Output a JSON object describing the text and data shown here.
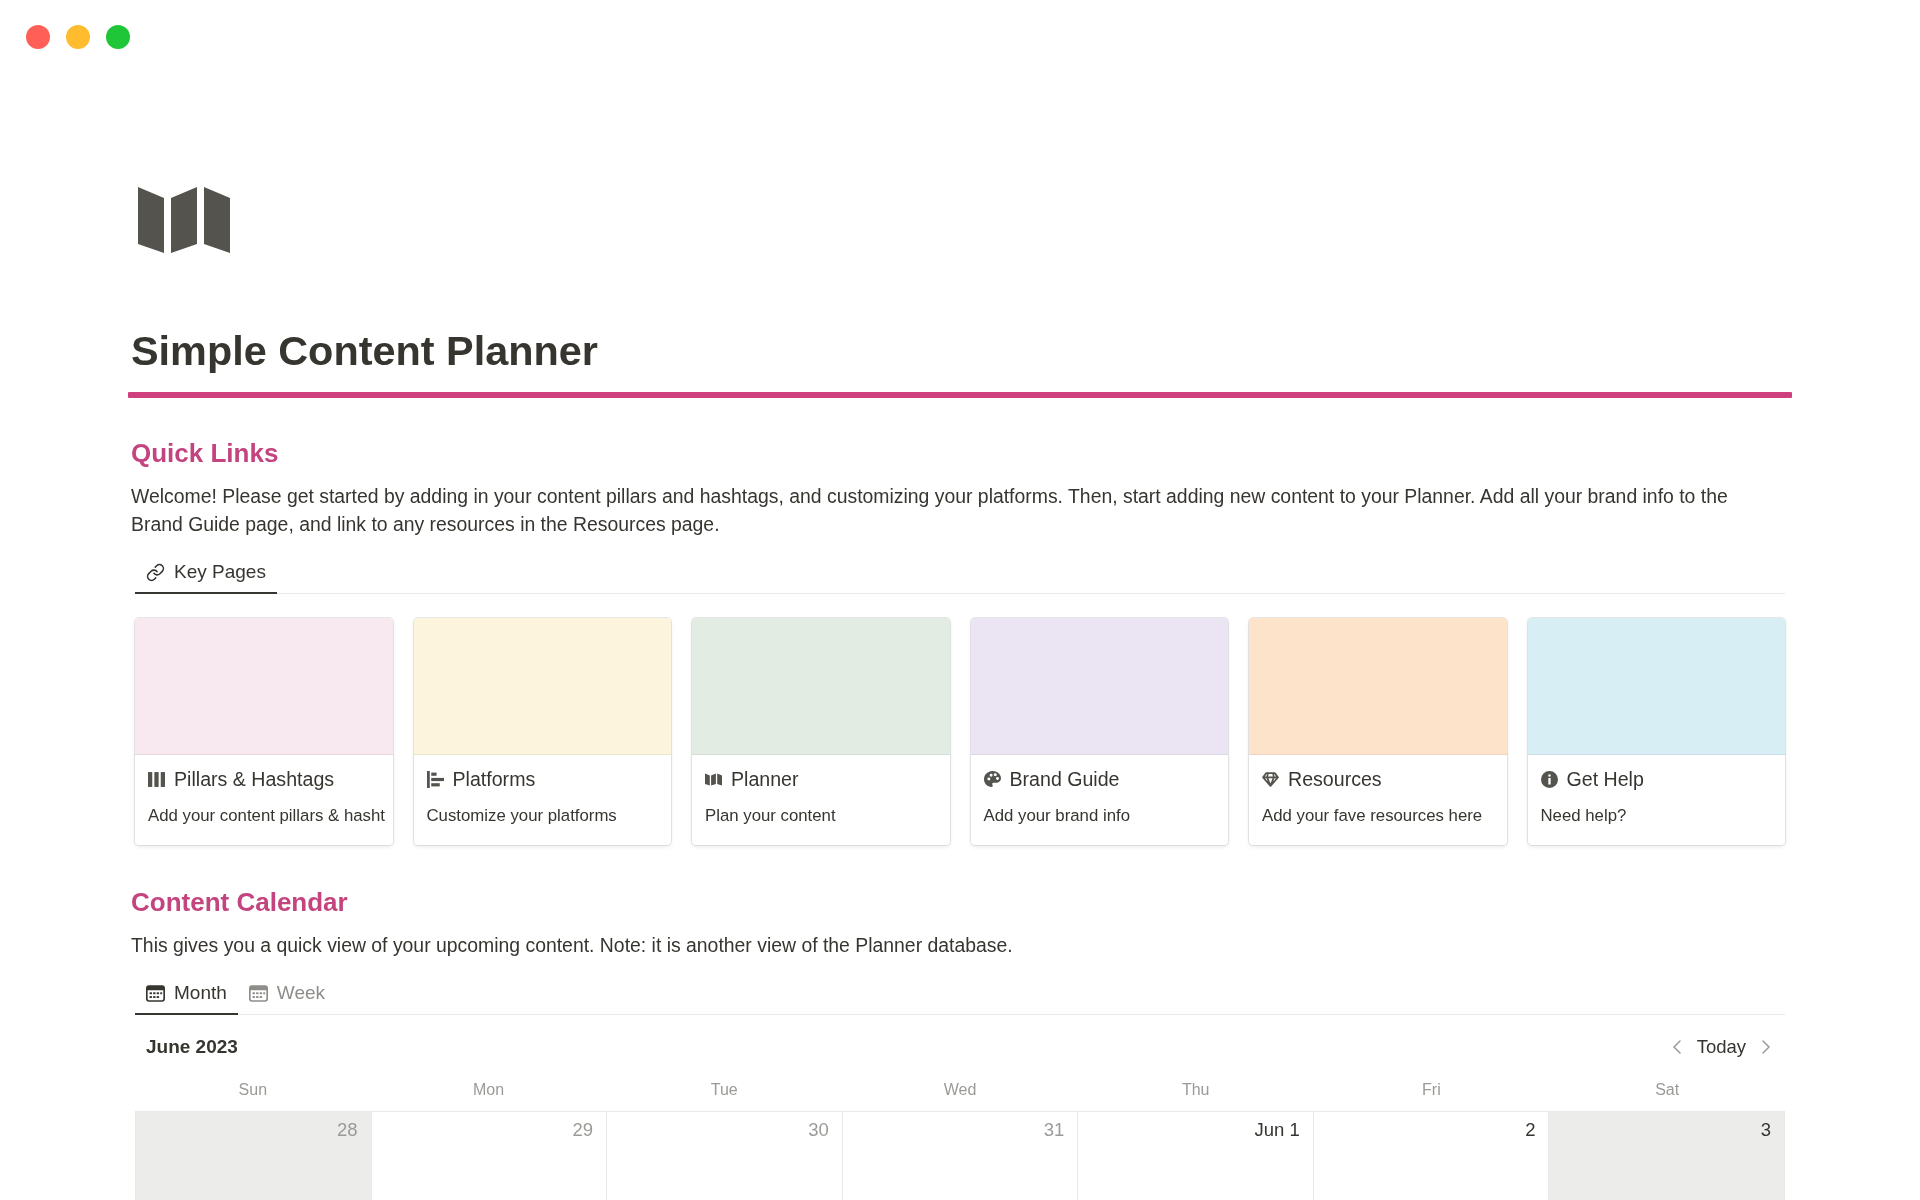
{
  "page": {
    "title": "Simple Content Planner"
  },
  "quick_links": {
    "heading": "Quick Links",
    "description": "Welcome! Please get started by adding in your content pillars and hashtags, and customizing your platforms. Then, start adding new content to your Planner. Add all your brand info to the Brand Guide page, and link to any resources in the Resources page.",
    "tabs": [
      {
        "label": "Key Pages",
        "selected": true
      }
    ],
    "cards": [
      {
        "title": "Pillars & Hashtags",
        "description": "Add your content pillars & hasht",
        "color": "#f8e8f0"
      },
      {
        "title": "Platforms",
        "description": "Customize your platforms",
        "color": "#fdf4dd"
      },
      {
        "title": "Planner",
        "description": "Plan your content",
        "color": "#e2ece3"
      },
      {
        "title": "Brand Guide",
        "description": "Add your brand info",
        "color": "#ebe5f3"
      },
      {
        "title": "Resources",
        "description": "Add your fave resources here",
        "color": "#fde3ca"
      },
      {
        "title": "Get Help",
        "description": "Need help?",
        "color": "#d7eef5"
      }
    ]
  },
  "content_calendar": {
    "heading": "Content Calendar",
    "description": "This gives you a quick view of your upcoming content. Note: it is another view of the Planner database.",
    "tabs": [
      {
        "label": "Month",
        "selected": true
      },
      {
        "label": "Week",
        "selected": false
      }
    ],
    "month_label": "June 2023",
    "today_button": "Today",
    "weekdays": [
      "Sun",
      "Mon",
      "Tue",
      "Wed",
      "Thu",
      "Fri",
      "Sat"
    ],
    "days": [
      {
        "label": "28",
        "current_month": false,
        "weekend": true
      },
      {
        "label": "29",
        "current_month": false,
        "weekend": false
      },
      {
        "label": "30",
        "current_month": false,
        "weekend": false
      },
      {
        "label": "31",
        "current_month": false,
        "weekend": false
      },
      {
        "label": "Jun 1",
        "current_month": true,
        "weekend": false
      },
      {
        "label": "2",
        "current_month": true,
        "weekend": false
      },
      {
        "label": "3",
        "current_month": true,
        "weekend": true
      }
    ]
  }
}
